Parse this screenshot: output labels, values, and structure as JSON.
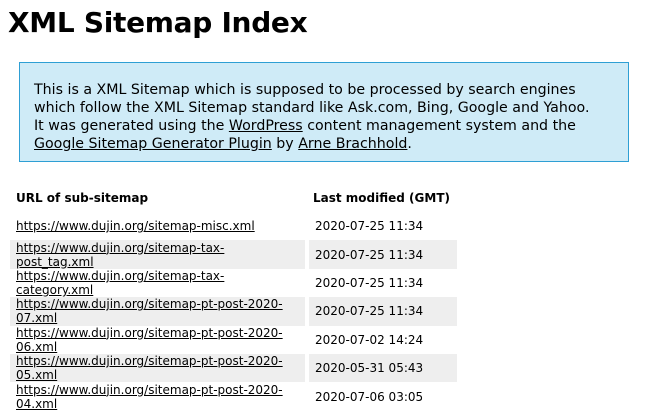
{
  "page": {
    "title": "XML Sitemap Index"
  },
  "intro": {
    "line1": "This is a XML Sitemap which is supposed to be processed by search engines which follow the XML Sitemap standard like Ask.com, Bing, Google and Yahoo.",
    "line2_prefix": "It was generated using the ",
    "link_wordpress": "WordPress",
    "line2_middle": " content management system and the ",
    "link_plugin": "Google Sitemap Generator Plugin",
    "line2_by": " by ",
    "link_author": "Arne Brachhold",
    "line2_end": "."
  },
  "table": {
    "headers": {
      "url": "URL of sub-sitemap",
      "modified": "Last modified (GMT)"
    },
    "rows": [
      {
        "url": "https://www.dujin.org/sitemap-misc.xml",
        "modified": "2020-07-25 11:34"
      },
      {
        "url": "https://www.dujin.org/sitemap-tax-post_tag.xml",
        "modified": "2020-07-25 11:34"
      },
      {
        "url": "https://www.dujin.org/sitemap-tax-category.xml",
        "modified": "2020-07-25 11:34"
      },
      {
        "url": "https://www.dujin.org/sitemap-pt-post-2020-07.xml",
        "modified": "2020-07-25 11:34"
      },
      {
        "url": "https://www.dujin.org/sitemap-pt-post-2020-06.xml",
        "modified": "2020-07-02 14:24"
      },
      {
        "url": "https://www.dujin.org/sitemap-pt-post-2020-05.xml",
        "modified": "2020-05-31 05:43"
      },
      {
        "url": "https://www.dujin.org/sitemap-pt-post-2020-04.xml",
        "modified": "2020-07-06 03:05"
      }
    ]
  }
}
